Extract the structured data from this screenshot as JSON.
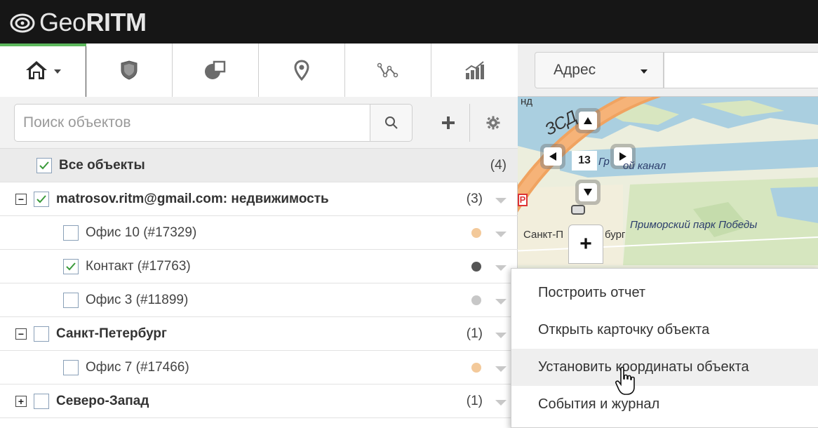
{
  "app": {
    "logo_prefix": "Geo",
    "logo_bold": "RITM"
  },
  "tabs": [
    {
      "name": "home",
      "icon": "home-icon",
      "active": true
    },
    {
      "name": "geofences",
      "icon": "shield-icon"
    },
    {
      "name": "layers",
      "icon": "shapes-icon"
    },
    {
      "name": "places",
      "icon": "map-pin-icon"
    },
    {
      "name": "routes",
      "icon": "route-icon"
    },
    {
      "name": "reports",
      "icon": "chart-icon"
    }
  ],
  "search": {
    "placeholder": "Поиск объектов",
    "value": ""
  },
  "tree": {
    "all": {
      "label": "Все объекты",
      "count": "(4)",
      "checked": true
    },
    "rows": [
      {
        "type": "group",
        "label": "matrosov.ritm@gmail.com: недвижимость",
        "count": "(3)",
        "checked": true,
        "expanded": true
      },
      {
        "type": "item",
        "label": "Офис 10 (#17329)",
        "checked": false,
        "status_color": "#f3c99a"
      },
      {
        "type": "item",
        "label": "Контакт (#17763)",
        "checked": true,
        "status_color": "#555555"
      },
      {
        "type": "item",
        "label": "Офис 3 (#11899)",
        "checked": false,
        "status_color": "#c7c7c7"
      },
      {
        "type": "group",
        "label": "Санкт-Петербург",
        "count": "(1)",
        "checked": false,
        "expanded": true
      },
      {
        "type": "item",
        "label": "Офис 7 (#17466)",
        "checked": false,
        "status_color": "#f3c99a"
      },
      {
        "type": "group",
        "label": "Северо-Запад",
        "count": "(1)",
        "checked": false,
        "expanded": false
      }
    ]
  },
  "map": {
    "address_select": "Адрес",
    "address_value": "",
    "zoom": "13",
    "labels": {
      "zsd": "ЗСД",
      "top_fragment": "нд",
      "canal": "ой канал",
      "canal_prefix": "Гр",
      "city": "Санкт-П",
      "city_suffix": "бург",
      "park": "Приморский парк Победы"
    }
  },
  "context_menu": {
    "items": [
      {
        "label": "Построить отчет"
      },
      {
        "label": "Открыть карточку объекта"
      },
      {
        "label": "Установить координаты объекта",
        "hover": true
      },
      {
        "label": "События и журнал"
      }
    ]
  },
  "colors": {
    "accent": "#5cb85c",
    "topbar": "#161616",
    "checkmark": "#3a9a3a"
  }
}
